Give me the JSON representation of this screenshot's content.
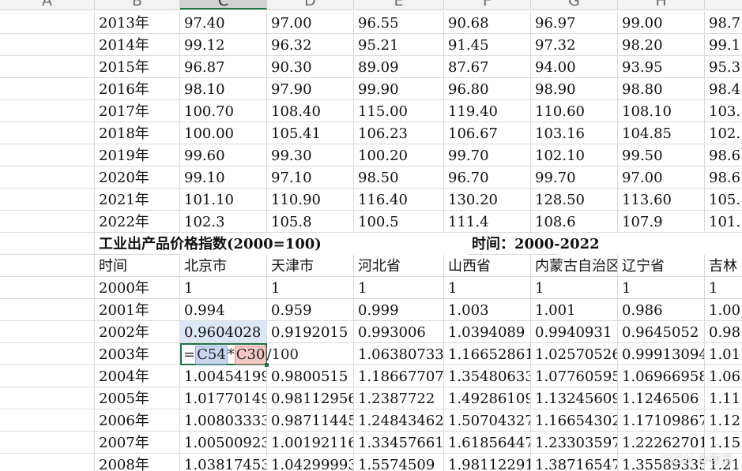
{
  "columns": [
    "A",
    "B",
    "C",
    "D",
    "E",
    "F",
    "G",
    "H"
  ],
  "active_column": "C",
  "rows_top": [
    [
      "2013年",
      "97.40",
      "97.00",
      "96.55",
      "90.68",
      "96.97",
      "99.00",
      "98.7"
    ],
    [
      "2014年",
      "99.12",
      "96.32",
      "95.21",
      "91.45",
      "97.32",
      "98.20",
      "99.1"
    ],
    [
      "2015年",
      "96.87",
      "90.30",
      "89.09",
      "87.67",
      "94.00",
      "93.95",
      "95.3"
    ],
    [
      "2016年",
      "98.10",
      "97.90",
      "99.90",
      "96.80",
      "98.90",
      "98.80",
      "98.4"
    ],
    [
      "2017年",
      "100.70",
      "108.40",
      "115.00",
      "119.40",
      "110.60",
      "108.10",
      "103."
    ],
    [
      "2018年",
      "100.00",
      "105.41",
      "106.23",
      "106.67",
      "103.16",
      "104.85",
      "102."
    ],
    [
      "2019年",
      "99.60",
      "99.30",
      "100.20",
      "99.70",
      "102.10",
      "99.50",
      "98.6"
    ],
    [
      "2020年",
      "99.10",
      "97.10",
      "98.50",
      "96.70",
      "99.70",
      "97.00",
      "98.6"
    ],
    [
      "2021年",
      "101.10",
      "110.90",
      "116.40",
      "130.20",
      "128.50",
      "113.60",
      "105."
    ],
    [
      "2022年",
      "102.3",
      "105.8",
      "100.5",
      "111.4",
      "108.6",
      "107.9",
      "101."
    ]
  ],
  "section": {
    "title": "工业出产品价格指数(2000=100)",
    "time_label": "时间：2000-2022"
  },
  "header_row": [
    "时间",
    "北京市",
    "天津市",
    "河北省",
    "山西省",
    "内蒙古自治区",
    "辽宁省",
    "吉林"
  ],
  "rows_bottom": [
    [
      "2000年",
      "1",
      "1",
      "1",
      "1",
      "1",
      "1",
      "1"
    ],
    [
      "2001年",
      "0.994",
      "0.959",
      "0.999",
      "1.003",
      "1.001",
      "0.986",
      "1.00"
    ],
    [
      "2002年",
      "0.9604028",
      "0.9192015",
      "0.993006",
      "1.0394089",
      "0.9940931",
      "0.9645052",
      "0.98"
    ],
    [
      "2003年",
      "",
      "",
      "1.06380733",
      "1.16652861",
      "1.02570526",
      "0.99913094",
      "1.01"
    ],
    [
      "2004年",
      "1.00454199",
      "0.9800515",
      "1.18667707",
      "1.35480633",
      "1.07760595",
      "1.06966958",
      "1.06"
    ],
    [
      "2005年",
      "1.01770149",
      "0.98112956",
      "1.2387722",
      "1.49286109",
      "1.13245609",
      "1.1246506",
      "1.11"
    ],
    [
      "2006年",
      "1.00803333",
      "0.98711445",
      "1.24843462",
      "1.50704327",
      "1.16654302",
      "1.17109867",
      "1.12"
    ],
    [
      "2007年",
      "1.00500923",
      "1.00192116",
      "1.33457661",
      "1.61856447",
      "1.23303597",
      "1.22262701",
      "1.15"
    ],
    [
      "2008年",
      "1.03817453",
      "1.04299993",
      "1.5574509",
      "1.98112291",
      "1.38716547",
      "1.35589335",
      "1.21"
    ]
  ],
  "formula": {
    "prefix": "=",
    "ref1": "C54",
    "operator": "*",
    "ref2": "C30",
    "suffix": "/100"
  },
  "watermark": "CSDN @夜淋"
}
